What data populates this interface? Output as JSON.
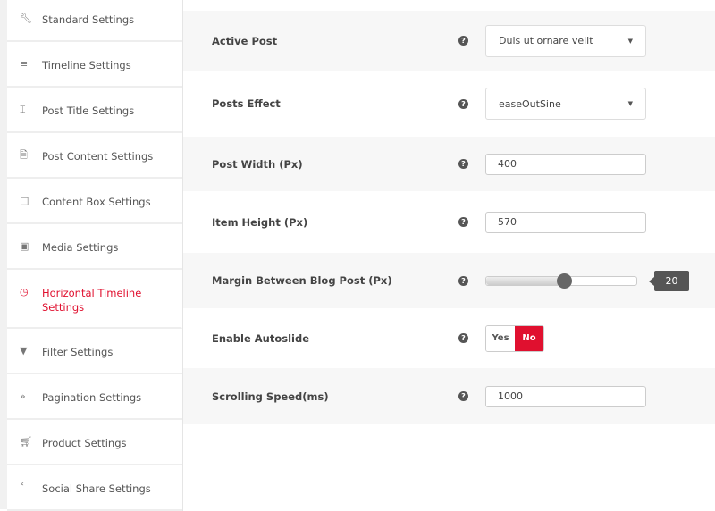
{
  "sidebar": {
    "items": [
      {
        "label": "Standard Settings",
        "icon": "wrench-icon"
      },
      {
        "label": "Timeline Settings",
        "icon": "align-center-icon"
      },
      {
        "label": "Post Title Settings",
        "icon": "text-height-icon"
      },
      {
        "label": "Post Content Settings",
        "icon": "file-icon"
      },
      {
        "label": "Content Box Settings",
        "icon": "square-icon"
      },
      {
        "label": "Media Settings",
        "icon": "image-icon"
      },
      {
        "label": "Horizontal Timeline Settings",
        "icon": "clock-icon",
        "active": true
      },
      {
        "label": "Filter Settings",
        "icon": "filter-icon"
      },
      {
        "label": "Pagination Settings",
        "icon": "double-chevron-icon"
      },
      {
        "label": "Product Settings",
        "icon": "cart-icon"
      },
      {
        "label": "Social Share Settings",
        "icon": "share-icon"
      }
    ]
  },
  "accent": "#e0102f",
  "settings": {
    "active_post": {
      "label": "Active Post",
      "value": "Duis ut ornare velit"
    },
    "posts_effect": {
      "label": "Posts Effect",
      "value": "easeOutSine"
    },
    "post_width": {
      "label": "Post Width (Px)",
      "value": "400"
    },
    "item_height": {
      "label": "Item Height (Px)",
      "value": "570"
    },
    "margin": {
      "label": "Margin Between Blog Post (Px)",
      "value": "20",
      "fraction": 0.52
    },
    "autoslide": {
      "label": "Enable Autoslide",
      "yes": "Yes",
      "no": "No",
      "selected": "No"
    },
    "scroll_speed": {
      "label": "Scrolling Speed(ms)",
      "value": "1000"
    }
  },
  "help_glyph": "?"
}
